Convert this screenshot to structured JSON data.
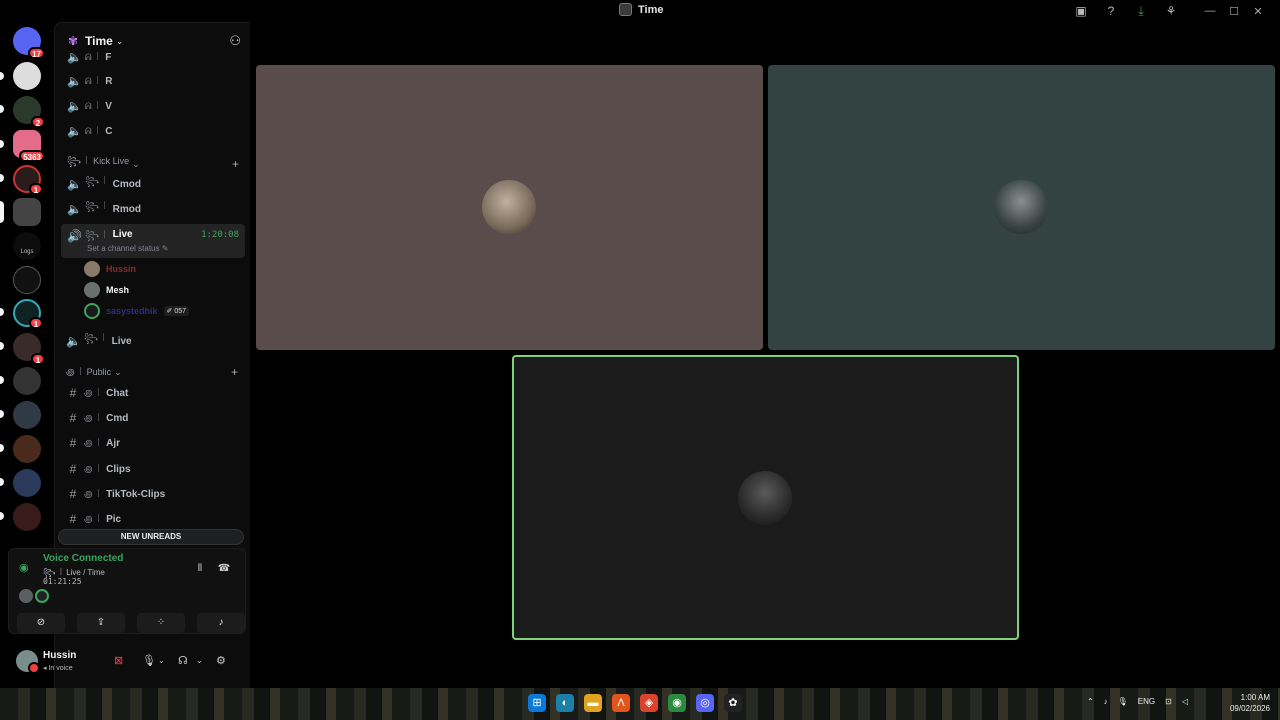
{
  "window": {
    "title": "Time",
    "window_controls": [
      "—",
      "☐",
      "✕"
    ]
  },
  "rail": {
    "servers": [
      {
        "name": "discord-home",
        "badge": "17"
      },
      {
        "name": "server-2",
        "badge": ""
      },
      {
        "name": "server-3",
        "badge": "2"
      },
      {
        "name": "server-4",
        "badge": "5363"
      },
      {
        "name": "server-5",
        "badge": "1"
      },
      {
        "name": "server-6",
        "badge": ""
      },
      {
        "name": "server-logs",
        "badge": "",
        "label": "Logs"
      },
      {
        "name": "server-8",
        "badge": ""
      },
      {
        "name": "server-9",
        "badge": "1"
      },
      {
        "name": "server-10",
        "badge": "1"
      },
      {
        "name": "server-11",
        "badge": ""
      },
      {
        "name": "server-12",
        "badge": ""
      },
      {
        "name": "server-13",
        "badge": ""
      },
      {
        "name": "server-14",
        "badge": ""
      },
      {
        "name": "server-15",
        "badge": ""
      }
    ]
  },
  "guild": {
    "name": "Time",
    "channels_top": [
      {
        "sub": "ᕱ ꒐",
        "name": "F"
      },
      {
        "sub": "ᕱ ꒐",
        "name": "R"
      },
      {
        "sub": "ᕱ ꒐",
        "name": "V"
      },
      {
        "sub": "ᕱ ꒐",
        "name": "C"
      }
    ],
    "cat_kick": "꧂ ꒐ Kick Live",
    "kick_channels": [
      {
        "sub": "꧂ ꒐",
        "name": "Cmod"
      },
      {
        "sub": "꧂ ꒐",
        "name": "Rmod"
      }
    ],
    "live_channel": {
      "sub": "꧂ ꒐",
      "name": "Live",
      "timer": "1:20:08",
      "status": "Set a channel status"
    },
    "voice_users": [
      {
        "name": "Hussin",
        "color": "#8b2a2a"
      },
      {
        "name": "Mesh",
        "color": "#f2f3f5"
      },
      {
        "name": "sasystedhik",
        "color": "#2a2f7a",
        "extra": "057"
      }
    ],
    "live2": {
      "sub": "꧂ ꒐",
      "name": "Live"
    },
    "cat_public": "꩜ ꒐ Public",
    "public_channels": [
      {
        "sub": "꩜ ꒐",
        "name": "Chat"
      },
      {
        "sub": "꩜ ꒐",
        "name": "Cmd"
      },
      {
        "sub": "꩜ ꒐",
        "name": "Ajr"
      },
      {
        "sub": "꩜ ꒐",
        "name": "Clips"
      },
      {
        "sub": "꩜ ꒐",
        "name": "TikTok-Clips"
      },
      {
        "sub": "꩜ ꒐",
        "name": "Pic"
      }
    ],
    "new_unreads": "NEW UNREADS"
  },
  "voice": {
    "title": "Voice Connected",
    "channel": "꧂ ꒐ Live / Time",
    "elapsed": "01:21:25"
  },
  "user": {
    "name": "Hussin",
    "status": "In voice"
  },
  "taskbar": {
    "lang": "ENG",
    "time": "1:00 AM",
    "date": "09/02/2026"
  },
  "colors": {
    "accent_green": "#3ba55c",
    "tile1": "#5a4c4b",
    "tile2": "#334341",
    "tile3": "#1b1b1b",
    "speaking_border": "#7fd07f"
  }
}
